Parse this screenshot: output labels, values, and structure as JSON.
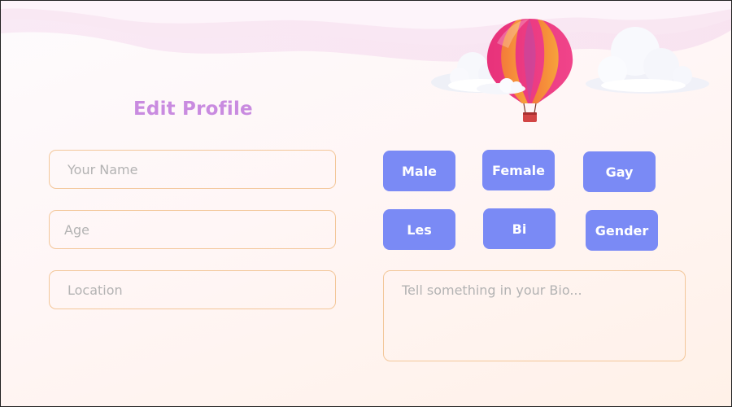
{
  "page": {
    "title": "Edit Profile"
  },
  "form": {
    "name_placeholder": "Your Name",
    "age_placeholder": "Age",
    "location_placeholder": "Location",
    "bio_placeholder": "Tell something in your Bio..."
  },
  "gender_options": [
    "Male",
    "Female",
    "Gay",
    "Les",
    "Bi",
    "Gender"
  ],
  "colors": {
    "title": "#c98be0",
    "chip_background": "#7a8af5",
    "chip_text": "#ffffff",
    "field_border": "#f3c79a",
    "placeholder": "#b3b3b3",
    "balloon_pink": "#f0448a",
    "balloon_orange": "#f7a33b"
  },
  "icons": {
    "balloon": "hot-air-balloon-icon",
    "cloud": "cloud-icon"
  }
}
